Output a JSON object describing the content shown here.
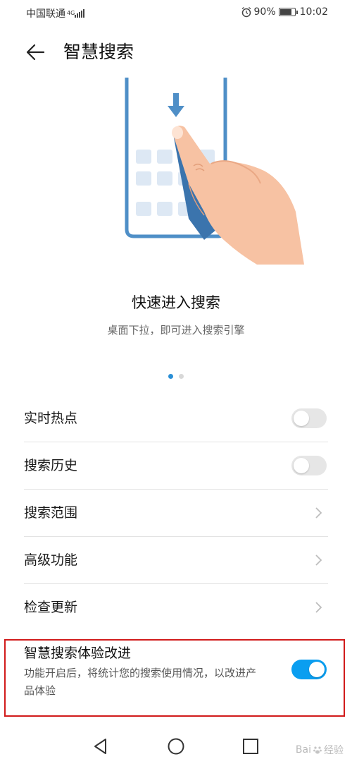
{
  "status_bar": {
    "carrier": "中国联通",
    "network_type": "4G",
    "battery_percent": "90%",
    "battery_level": 0.9,
    "time": "10:02"
  },
  "header": {
    "title": "智慧搜索",
    "back_icon": "arrow-left-icon"
  },
  "feature_slide": {
    "title": "快速进入搜索",
    "subtitle": "桌面下拉，即可进入搜索引擎",
    "page_count": 2,
    "active_page": 1
  },
  "settings": {
    "items": [
      {
        "label": "实时热点",
        "control": "toggle",
        "on": false
      },
      {
        "label": "搜索历史",
        "control": "toggle",
        "on": false
      },
      {
        "label": "搜索范围",
        "control": "chevron"
      },
      {
        "label": "高级功能",
        "control": "chevron"
      },
      {
        "label": "检查更新",
        "control": "chevron"
      }
    ]
  },
  "experience_improvement": {
    "title": "智慧搜索体验改进",
    "description": "功能开启后，将统计您的搜索使用情况，以改进产品体验",
    "on": true
  },
  "nav_bar": {
    "back_icon": "triangle-back-icon",
    "home_icon": "circle-home-icon",
    "recents_icon": "square-recents-icon"
  },
  "watermark": {
    "text_left": "Bai",
    "text_right": "经验"
  },
  "colors": {
    "accent": "#0a9ef0",
    "pager_active": "#2a8fd6",
    "highlight_border": "#d11b1b"
  }
}
